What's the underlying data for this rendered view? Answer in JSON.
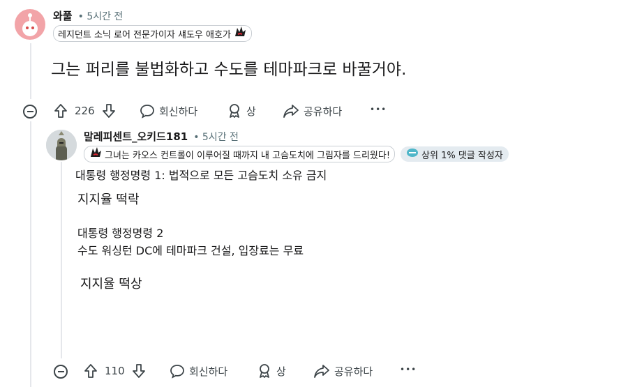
{
  "comment1": {
    "username": "와풀",
    "time": "• 5시간 전",
    "flair": "레지던트 소닉 로어 전문가이자 섀도우 애호가",
    "body": "그는 퍼리를 불법화하고 수도를 테마파크로 바꿀거야.",
    "votes": "226",
    "reply_label": "회신하다",
    "award_label": "상",
    "share_label": "공유하다",
    "more_label": "•••"
  },
  "comment2": {
    "username": "말레피센트_오키드181",
    "time": "• 5시간 전",
    "flair": "그녀는 카오스 컨트롤이 이루어질 때까지 내 고슴도치에 그림자를 드리웠다!",
    "badge": "상위 1% 댓글 작성자",
    "lines": [
      "대통령 행정명령 1: 법적으로 모든 고슴도치 소유 금지",
      "지지율 떡락",
      "대통령 행정명령 2",
      "수도 워싱턴 DC에 테마파크 건설, 입장료는 무료",
      "지지율 떡상"
    ],
    "votes": "110",
    "reply_label": "회신하다",
    "award_label": "상",
    "share_label": "공유하다",
    "more_label": "•••"
  },
  "icons": [
    "snoo-avatar",
    "knight-avatar",
    "shadow-flair-icon",
    "top-commenter-icon",
    "upvote-icon",
    "downvote-icon",
    "reply-icon",
    "award-icon",
    "share-icon",
    "collapse-icon",
    "more-icon"
  ]
}
